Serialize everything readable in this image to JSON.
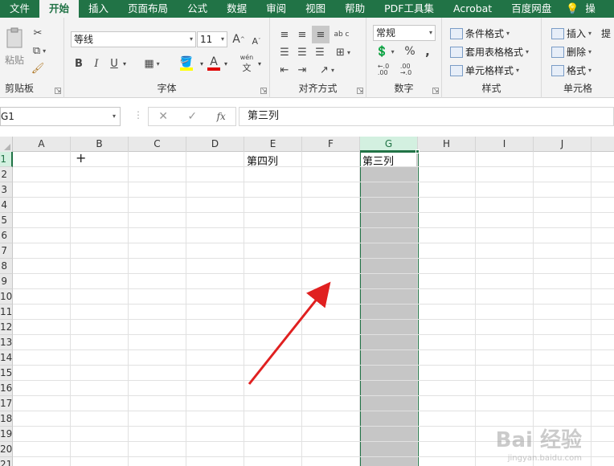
{
  "menu": {
    "tabs": [
      "文件",
      "开始",
      "插入",
      "页面布局",
      "公式",
      "数据",
      "审阅",
      "视图",
      "帮助",
      "PDF工具集",
      "Acrobat",
      "百度网盘"
    ],
    "active_index": 1,
    "overflow_label": "操"
  },
  "ribbon": {
    "clipboard": {
      "paste_label": "粘贴",
      "group_label": "剪贴板"
    },
    "font": {
      "font_name": "等线",
      "font_size": "11",
      "group_label": "字体",
      "bold": "B",
      "italic": "I",
      "underline": "U",
      "font_color_letter": "A",
      "phonetic_label": "wén"
    },
    "alignment": {
      "group_label": "对齐方式",
      "wrap_label": "ab c"
    },
    "number": {
      "format_value": "常规",
      "percent": "%",
      "comma": ",",
      "group_label": "数字"
    },
    "styles": {
      "conditional_label": "条件格式",
      "table_label": "套用表格格式",
      "cell_style_label": "单元格样式",
      "group_label": "样式"
    },
    "cells": {
      "insert_label": "插入",
      "delete_label": "删除",
      "format_label": "格式",
      "group_label": "单元格",
      "overflow_label": "提"
    }
  },
  "formula_bar": {
    "name_box": "G1",
    "fx_label": "fx",
    "content": "第三列"
  },
  "sheet": {
    "columns": [
      "A",
      "B",
      "C",
      "D",
      "E",
      "F",
      "G",
      "H",
      "I",
      "J"
    ],
    "rows": [
      "1",
      "2",
      "3",
      "4",
      "5",
      "6",
      "7",
      "8",
      "9",
      "10",
      "11",
      "12",
      "13",
      "14",
      "15",
      "16",
      "17",
      "18",
      "19",
      "20",
      "21"
    ],
    "selected_column": "G",
    "cells": {
      "E1": "第四列",
      "G1": "第三列"
    }
  },
  "colors": {
    "accent": "#217346",
    "arrow": "#e02020",
    "selection_fill": "#c6c6c6"
  },
  "watermark": {
    "text": "Bai 经验",
    "sub": "jingyan.baidu.com"
  }
}
